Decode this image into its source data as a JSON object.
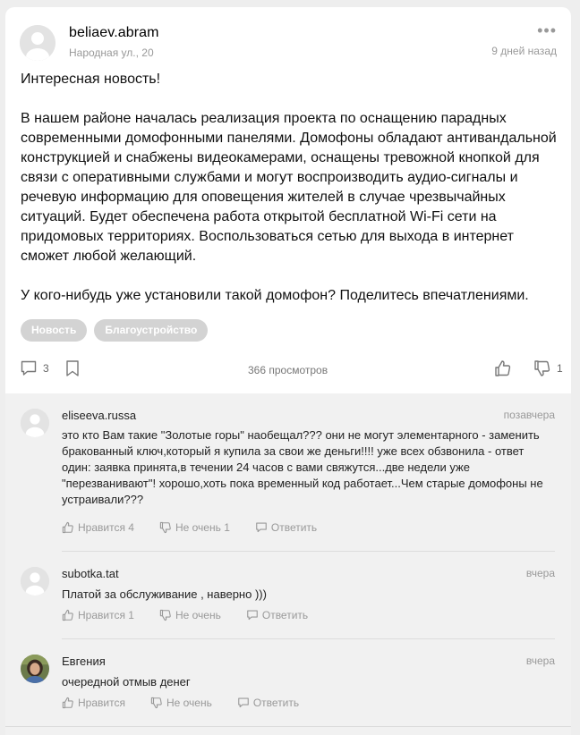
{
  "post": {
    "author": "beliaev.abram",
    "address": "Народная ул., 20",
    "time": "9 дней назад",
    "more": "•••",
    "paragraphs": [
      "Интересная новость!",
      "В нашем районе началась реализация проекта по оснащению парадных современными домофонными панелями. Домофоны обладают антивандальной конструкцией и снабжены видеокамерами, оснащены тревожной кнопкой для связи с оперативными службами и могут воспроизводить аудио-сигналы и речевую информацию для оповещения жителей в случае чрезвычайных ситуаций. Будет обеспечена работа открытой бесплатной Wi-Fi сети на придомовых территориях. Воспользоваться сетью для выхода в интернет сможет любой желающий.",
      "У кого-нибудь уже установили такой домофон? Поделитесь впечатлениями."
    ],
    "tags": [
      "Новость",
      "Благоустройство"
    ],
    "comments_count": "3",
    "views": "366 просмотров",
    "dislikes": "1"
  },
  "comments": [
    {
      "author": "eliseeva.russa",
      "time": "позавчера",
      "text": "это кто Вам такие \"Золотые горы\" наобещал??? они не могут элементарного - заменить бракованный ключ,который я купила за свои же деньги!!!! уже всех обзвонила - ответ один: заявка принята,в течении 24 часов с вами свяжутся...две недели уже \"перезванивают\"! хорошо,хоть пока временный код работает...Чем старые домофоны не устраивали???",
      "like_label": "Нравится 4",
      "dislike_label": "Не очень 1",
      "reply_label": "Ответить"
    },
    {
      "author": "subotka.tat",
      "time": "вчера",
      "text": "Платой за обслуживание , наверно )))",
      "like_label": "Нравится 1",
      "dislike_label": "Не очень",
      "reply_label": "Ответить"
    },
    {
      "author": "Евгения",
      "time": "вчера",
      "text": "очередной отмыв денег",
      "like_label": "Нравится",
      "dislike_label": "Не очень",
      "reply_label": "Ответить"
    }
  ],
  "colors": {
    "page_bg": "#eeeeee",
    "card_bg": "#ffffff",
    "comments_bg": "#f1f1f1",
    "tag_bg": "#d3d3d3",
    "muted_text": "#999999"
  },
  "icons": [
    "default-avatar-icon",
    "more-icon",
    "comment-icon",
    "bookmark-icon",
    "thumb-up-icon",
    "thumb-down-icon",
    "reply-icon",
    "user-photo-avatar"
  ]
}
